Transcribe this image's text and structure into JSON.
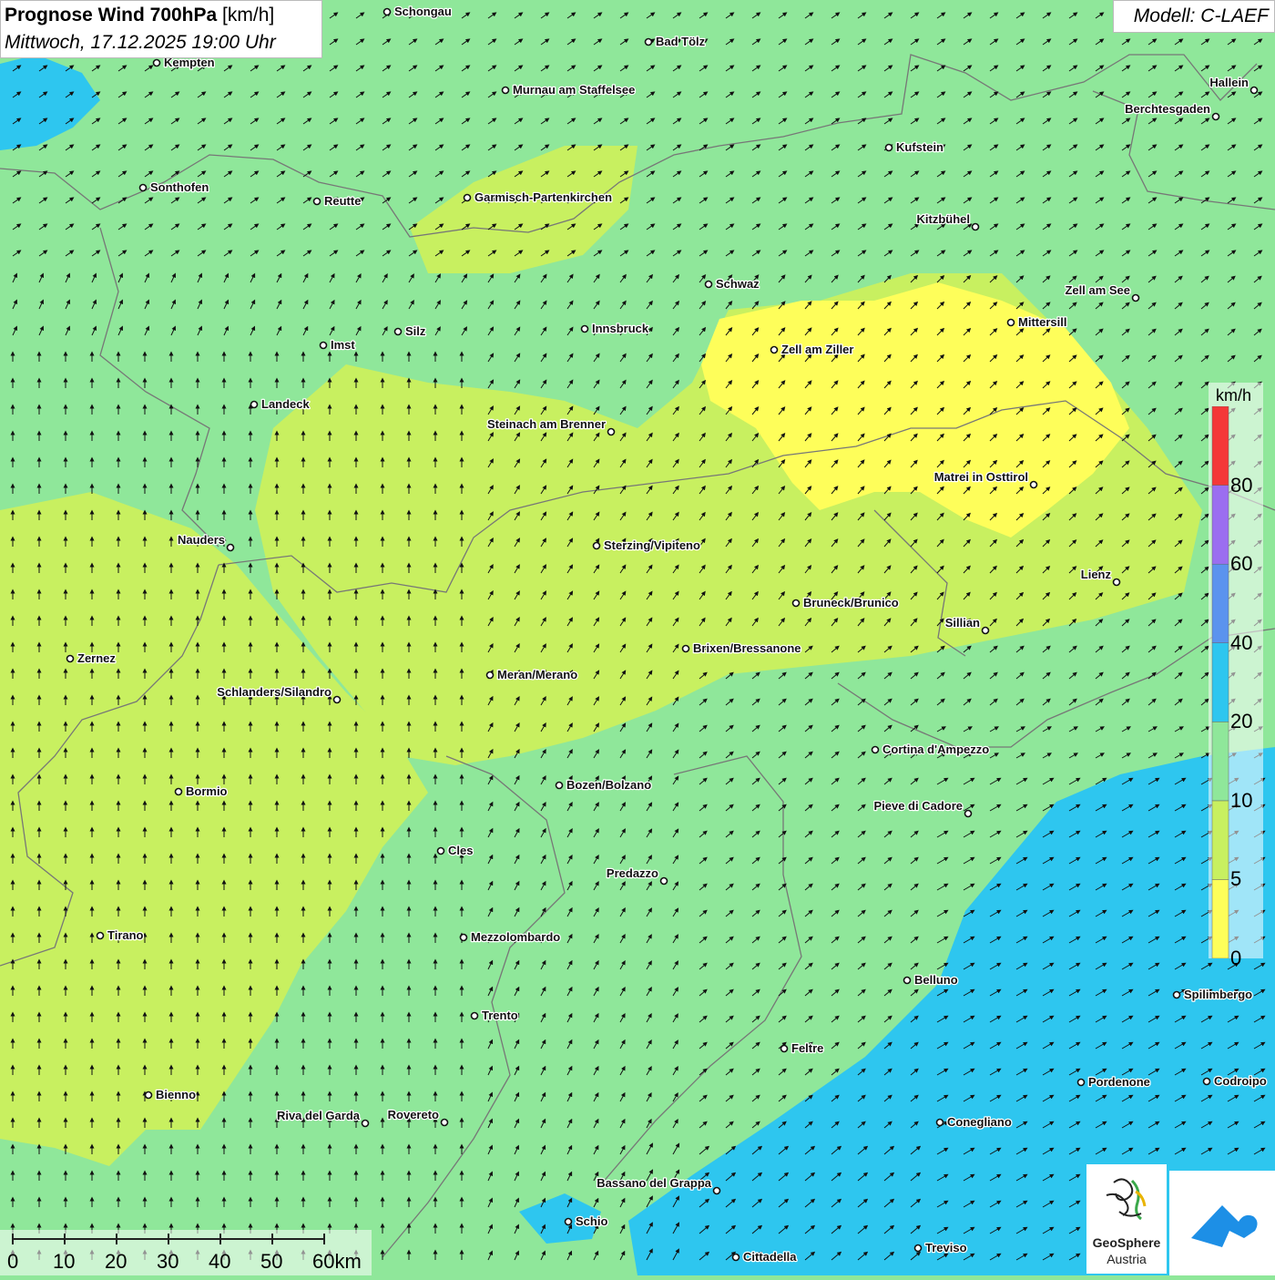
{
  "title": {
    "bold": "Prognose Wind 700hPa",
    "unit": "[km/h]",
    "datetime": "Mittwoch, 17.12.2025 19:00 Uhr"
  },
  "model_label": "Modell: C-LAEF",
  "legend": {
    "unit": "km/h",
    "ticks": [
      "0",
      "5",
      "10",
      "20",
      "40",
      "60",
      "80"
    ],
    "colors": [
      "#fefe5a",
      "#c8f060",
      "#8fe79a",
      "#2ec6ef",
      "#5b93ee",
      "#9b6ef0",
      "#f43838"
    ]
  },
  "scale_bar": {
    "labels": [
      "0",
      "10",
      "20",
      "30",
      "40",
      "50",
      "60km"
    ]
  },
  "logos": {
    "geosphere_name": "GeoSphere",
    "geosphere_country": "Austria",
    "geosphere_icon": "geosphere-swirl-icon",
    "app_icon": "wetter-app-icon"
  },
  "cities": [
    {
      "name": "Schongau",
      "side": "right"
    },
    {
      "name": "Bad Tölz",
      "side": "right"
    },
    {
      "name": "Kempten",
      "side": "right"
    },
    {
      "name": "Murnau am Staffelsee",
      "side": "right"
    },
    {
      "name": "Hallein",
      "side": "left"
    },
    {
      "name": "Berchtesgaden",
      "side": "left"
    },
    {
      "name": "Kufstein",
      "side": "right"
    },
    {
      "name": "Sonthofen",
      "side": "right"
    },
    {
      "name": "Reutte",
      "side": "right"
    },
    {
      "name": "Garmisch-Partenkirchen",
      "side": "right"
    },
    {
      "name": "Kitzbühel",
      "side": "left"
    },
    {
      "name": "Schwaz",
      "side": "right"
    },
    {
      "name": "Zell am See",
      "side": "left"
    },
    {
      "name": "Mittersill",
      "side": "right"
    },
    {
      "name": "Innsbruck",
      "side": "right"
    },
    {
      "name": "Silz",
      "side": "right"
    },
    {
      "name": "Imst",
      "side": "right"
    },
    {
      "name": "Zell am Ziller",
      "side": "right"
    },
    {
      "name": "Landeck",
      "side": "right"
    },
    {
      "name": "Steinach am Brenner",
      "side": "left"
    },
    {
      "name": "Matrei in Osttirol",
      "side": "left"
    },
    {
      "name": "Nauders",
      "side": "left"
    },
    {
      "name": "Sterzing/Vipiteno",
      "side": "right"
    },
    {
      "name": "Lienz",
      "side": "left"
    },
    {
      "name": "Bruneck/Brunico",
      "side": "right"
    },
    {
      "name": "Sillian",
      "side": "left"
    },
    {
      "name": "Brixen/Bressanone",
      "side": "right"
    },
    {
      "name": "Zernez",
      "side": "right"
    },
    {
      "name": "Meran/Merano",
      "side": "right"
    },
    {
      "name": "Schlanders/Silandro",
      "side": "left"
    },
    {
      "name": "Cortina d'Ampezzo",
      "side": "right"
    },
    {
      "name": "Bozen/Bolzano",
      "side": "right"
    },
    {
      "name": "Bormio",
      "side": "right"
    },
    {
      "name": "Pieve di Cadore",
      "side": "left"
    },
    {
      "name": "Cles",
      "side": "right"
    },
    {
      "name": "Predazzo",
      "side": "left"
    },
    {
      "name": "Tirano",
      "side": "right"
    },
    {
      "name": "Mezzolombardo",
      "side": "right"
    },
    {
      "name": "Belluno",
      "side": "right"
    },
    {
      "name": "Spilimbergo",
      "side": "right"
    },
    {
      "name": "Trento",
      "side": "right"
    },
    {
      "name": "Feltre",
      "side": "right"
    },
    {
      "name": "Pordenone",
      "side": "right"
    },
    {
      "name": "Codroipo",
      "side": "right"
    },
    {
      "name": "Bienno",
      "side": "right"
    },
    {
      "name": "Riva del Garda",
      "side": "left"
    },
    {
      "name": "Rovereto",
      "side": "left"
    },
    {
      "name": "Conegliano",
      "side": "right"
    },
    {
      "name": "Bassano del Grappa",
      "side": "left"
    },
    {
      "name": "Schio",
      "side": "right"
    },
    {
      "name": "Cittadella",
      "side": "right"
    },
    {
      "name": "Treviso",
      "side": "right"
    }
  ]
}
